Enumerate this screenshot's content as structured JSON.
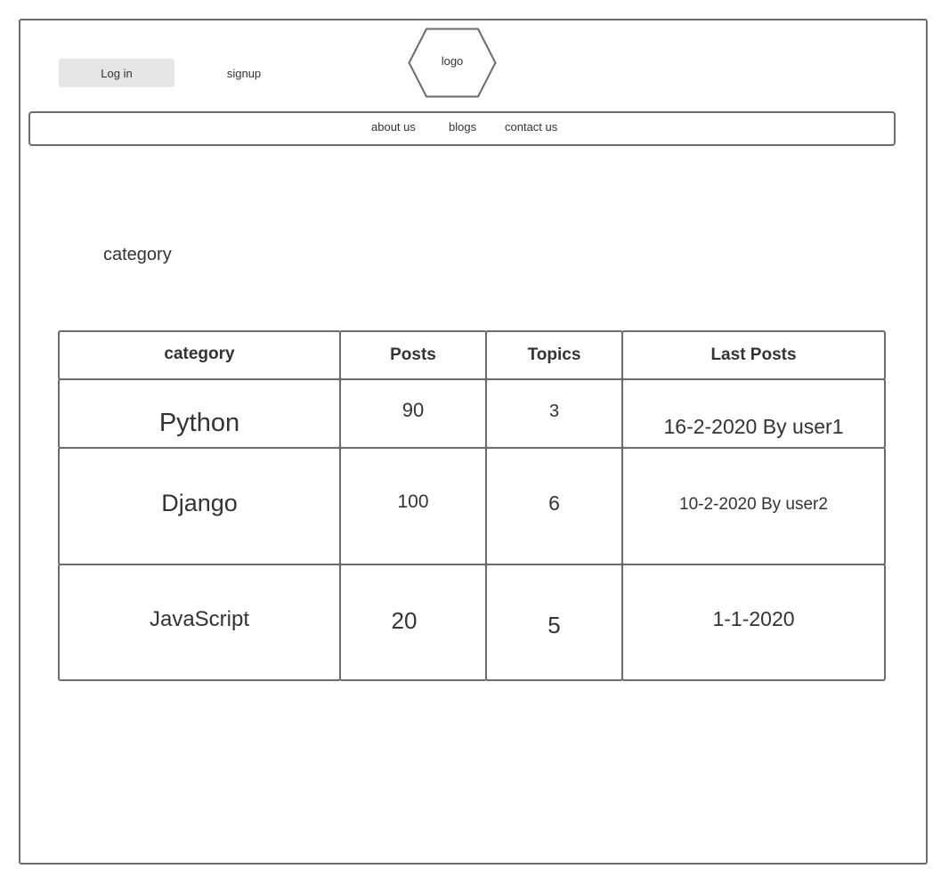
{
  "header": {
    "login_label": "Log in",
    "signup_label": "signup",
    "logo_label": "logo"
  },
  "nav": {
    "items": [
      {
        "label": "about us"
      },
      {
        "label": "blogs"
      },
      {
        "label": "contact us"
      }
    ]
  },
  "main": {
    "section_title": "category"
  },
  "table": {
    "columns": [
      "category",
      "Posts",
      "Topics",
      "Last Posts"
    ],
    "rows": [
      {
        "category": "Python",
        "posts": "90",
        "topics": "3",
        "last_post": "16-2-2020 By user1"
      },
      {
        "category": "Django",
        "posts": "100",
        "topics": "6",
        "last_post": "10-2-2020 By user2"
      },
      {
        "category": "JavaScript",
        "posts": "20",
        "topics": "5",
        "last_post": "1-1-2020"
      }
    ]
  }
}
